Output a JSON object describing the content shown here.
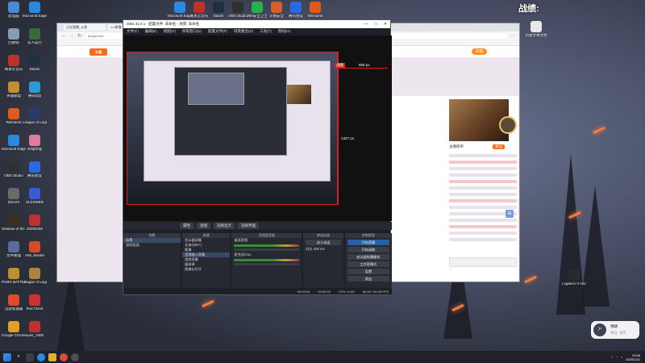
{
  "desktop": {
    "top_right_text": "战绩:",
    "icons_left": [
      {
        "label": "此电脑",
        "color": "#4a8ad6"
      },
      {
        "label": "Microsoft Edge",
        "color": "#2a8ae0"
      },
      {
        "label": "回收站",
        "color": "#8a9ab0"
      },
      {
        "label": "双人成行",
        "color": "#3a6a3a"
      },
      {
        "label": "网易云音乐",
        "color": "#c0302a"
      },
      {
        "label": "Steam",
        "color": "#203040"
      },
      {
        "label": "英雄联盟",
        "color": "#c09030"
      },
      {
        "label": "腾讯QQ",
        "color": "#2a9ad6"
      },
      {
        "label": "WeGame",
        "color": "#e05a20"
      },
      {
        "label": "League of Legends",
        "color": "#2a3a6a"
      },
      {
        "label": "Microsoft Edge",
        "color": "#2a8ae0"
      },
      {
        "label": "哔哩哔哩",
        "color": "#e07aa0"
      },
      {
        "label": "OBS Studio",
        "color": "#303030"
      },
      {
        "label": "腾讯会议",
        "color": "#2a6ae0"
      },
      {
        "label": "DirectX",
        "color": "#6a6a6a"
      },
      {
        "label": "ZLDSWEB",
        "color": "#3a5ad6"
      },
      {
        "label": "Shadow of the Tomb",
        "color": "#3a3020"
      },
      {
        "label": "20250402",
        "color": "#c03030"
      },
      {
        "label": "文件整理",
        "color": "#5a6a9a"
      },
      {
        "label": "AIM_Master",
        "color": "#d64a2a"
      },
      {
        "label": "PUBG BATTLEGR.",
        "color": "#c09030"
      },
      {
        "label": "League of Legends",
        "color": "#b08040"
      },
      {
        "label": "迅游加速器",
        "color": "#e04a2a"
      },
      {
        "label": "Riot Client",
        "color": "#d03030"
      },
      {
        "label": "Google Chrome",
        "color": "#e0a020"
      },
      {
        "label": "eyes_1000",
        "color": "#c03030"
      }
    ],
    "icons_top": [
      {
        "label": "Microsoft Edge",
        "color": "#2a8ae0"
      },
      {
        "label": "网易云音乐",
        "color": "#c0302a"
      },
      {
        "label": "Steam",
        "color": "#203040"
      },
      {
        "label": "OBS Studio",
        "color": "#303030"
      },
      {
        "label": "360安全卫士",
        "color": "#2ab04a"
      },
      {
        "label": "火绒安全",
        "color": "#d06030"
      },
      {
        "label": "腾讯会议",
        "color": "#2a6ae0"
      },
      {
        "label": "WeGame",
        "color": "#e05a20"
      }
    ],
    "right_icons": [
      {
        "label": "新建文本文档",
        "color": "#e8e8e8"
      },
      {
        "label": "Logitech G HUB",
        "color": "#2a2a2a"
      }
    ]
  },
  "browser": {
    "tabs": [
      "正在直播_斗鱼",
      "1.0直播",
      "斗鱼直播"
    ],
    "url": "douyu.com",
    "logo": "斗鱼",
    "open_button": "开播",
    "chat_header": "主播榜单",
    "follow": "关注"
  },
  "obs": {
    "title": "OBS 31.0.1 - 配置文件: 未命名 - 场景: 未命名",
    "menus": [
      "文件(F)",
      "编辑(E)",
      "视图(V)",
      "停靠窗口(D)",
      "配置文件(P)",
      "场景集合(S)",
      "工具(T)",
      "帮助(H)"
    ],
    "guide_labels": {
      "top": "550 px",
      "right": "1327 px",
      "corner": "战绩"
    },
    "source_toolbar": [
      "属性",
      "滤镜",
      "选择显示",
      "选择界面"
    ],
    "docks": {
      "scenes": {
        "title": "场景",
        "items": [
          "场景",
          "游戏画面"
        ]
      },
      "sources": {
        "title": "来源",
        "items": [
          "显示器采集",
          "文本(GDI+)",
          "图像",
          "音频输入采集",
          "游戏采集",
          "媒体源",
          "图像幻灯片"
        ],
        "selected": 3
      },
      "mixer": {
        "title": "音频混音器",
        "items": [
          "桌面音频",
          "麦克风/Aux"
        ]
      },
      "transitions": {
        "title": "转场动画",
        "items": [
          "淡入淡出",
          "时长 300 ms"
        ]
      },
      "controls": {
        "title": "控制按钮",
        "buttons": [
          "开始直播",
          "开始录制",
          "启动虚拟摄像机",
          "工作室模式",
          "设置",
          "退出"
        ]
      }
    },
    "status": [
      "00:00:00",
      "00:00:00",
      "CPU: 0.4%",
      "60.00 / 60.00 FPS"
    ]
  },
  "widget": {
    "temp": "7°",
    "t1": "晴朗",
    "t2": "今日 · 天气"
  },
  "taskbar": {
    "clock_time": "23:08",
    "clock_date": "2025/12/1"
  },
  "colors": {
    "accent": "#ff6a1a",
    "guide": "#e02020"
  }
}
